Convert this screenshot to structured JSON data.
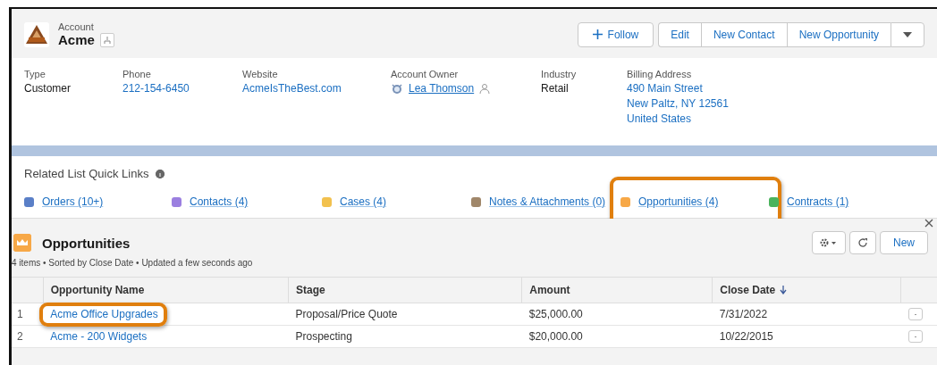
{
  "header": {
    "object_type": "Account",
    "title": "Acme",
    "buttons": [
      {
        "label": "Follow",
        "kind": "follow"
      },
      {
        "label": "Edit",
        "kind": "plain"
      },
      {
        "label": "New Contact",
        "kind": "plain"
      },
      {
        "label": "New Opportunity",
        "kind": "plain"
      },
      {
        "kind": "menu"
      }
    ]
  },
  "fields": [
    {
      "label": "Type",
      "values": [
        "Customer"
      ],
      "kind": "text"
    },
    {
      "label": "Phone",
      "values": [
        "212-154-6450"
      ],
      "kind": "link"
    },
    {
      "label": "Website",
      "values": [
        "AcmeIsTheBest.com"
      ],
      "kind": "link"
    },
    {
      "label": "Account Owner",
      "values": [
        "Lea Thomson"
      ],
      "kind": "owner"
    },
    {
      "label": "Industry",
      "values": [
        "Retail"
      ],
      "kind": "text"
    },
    {
      "label": "Billing Address",
      "values": [
        "490 Main Street",
        "New Paltz, NY 12561",
        "United States"
      ],
      "kind": "link"
    }
  ],
  "quick_links": {
    "title": "Related List Quick Links",
    "items": [
      {
        "label": "Orders (10+)",
        "color": "#5a7fc7",
        "highlighted": false
      },
      {
        "label": "Contacts (4)",
        "color": "#9b7fe0",
        "highlighted": false
      },
      {
        "label": "Cases (4)",
        "color": "#f2c14e",
        "highlighted": false
      },
      {
        "label": "Notes & Attachments (0)",
        "color": "#a0876a",
        "highlighted": false
      },
      {
        "label": "Opportunities (4)",
        "color": "#f7a847",
        "highlighted": true
      },
      {
        "label": "Contracts (1)",
        "color": "#4bb35d",
        "highlighted": false
      }
    ]
  },
  "related_list": {
    "title": "Opportunities",
    "summary": "4 items • Sorted by Close Date • Updated a few seconds ago",
    "new_button": "New",
    "columns": [
      {
        "label": "Opportunity Name",
        "sorted": false
      },
      {
        "label": "Stage",
        "sorted": false
      },
      {
        "label": "Amount",
        "sorted": false
      },
      {
        "label": "Close Date",
        "sorted": true
      }
    ],
    "rows": [
      {
        "number": "1",
        "name": "Acme Office Upgrades",
        "stage": "Proposal/Price Quote",
        "amount": "$25,000.00",
        "close_date": "7/31/2022",
        "highlighted": true
      },
      {
        "number": "2",
        "name": "Acme - 200 Widgets",
        "stage": "Prospecting",
        "amount": "$20,000.00",
        "close_date": "10/22/2015",
        "highlighted": false
      }
    ]
  }
}
